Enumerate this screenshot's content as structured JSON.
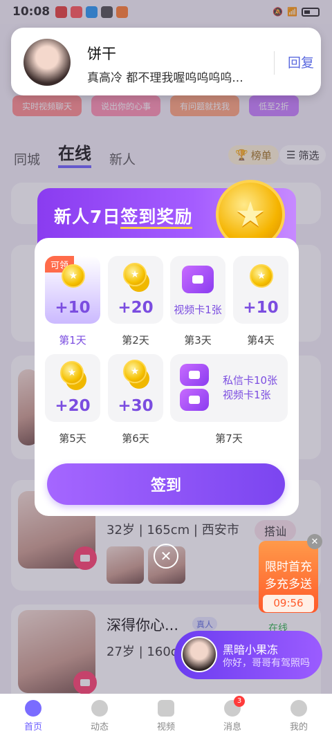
{
  "status_bar": {
    "time": "10:08"
  },
  "notification": {
    "name": "饼干",
    "message": "真高冷 都不理我喔呜呜呜呜...",
    "reply": "回复"
  },
  "promo_row": [
    "实时视频聊天",
    "说出你的心事",
    "有问题就找我",
    "低至2折"
  ],
  "tabs": {
    "city": "同城",
    "online": "在线",
    "new": "新人",
    "rank": "榜单",
    "filter": "筛选"
  },
  "cards": [
    {
      "info": "32岁 | 165cm | 西安市",
      "action": "搭讪"
    },
    {
      "name": "深得你心...",
      "verified": "真人",
      "info": "27岁 | 160c",
      "status": "在线"
    }
  ],
  "checkin": {
    "title_part1": "新人7日",
    "title_part2": "签到奖励",
    "claim_tag": "可领",
    "days": [
      {
        "label": "第1天",
        "value": "+10"
      },
      {
        "label": "第2天",
        "value": "+20"
      },
      {
        "label": "第3天",
        "value": "视频卡1张"
      },
      {
        "label": "第4天",
        "value": "+10"
      },
      {
        "label": "第5天",
        "value": "+20"
      },
      {
        "label": "第6天",
        "value": "+30"
      },
      {
        "label": "第7天",
        "value1": "私信卡10张",
        "value2": "视频卡1张"
      }
    ],
    "button": "签到"
  },
  "promo_float": {
    "line1": "限时首充",
    "line2": "多充多送",
    "timer": "09:56"
  },
  "chat_float": {
    "name": "黑暗小果冻",
    "message": "你好，哥哥有驾照吗"
  },
  "tabbar": [
    {
      "label": "首页"
    },
    {
      "label": "动态"
    },
    {
      "label": "视频"
    },
    {
      "label": "消息",
      "badge": "3"
    },
    {
      "label": "我的"
    }
  ],
  "colors": {
    "accent": "#7b45f0",
    "brand_purple": "#a45cff",
    "coin": "#f5c000"
  }
}
